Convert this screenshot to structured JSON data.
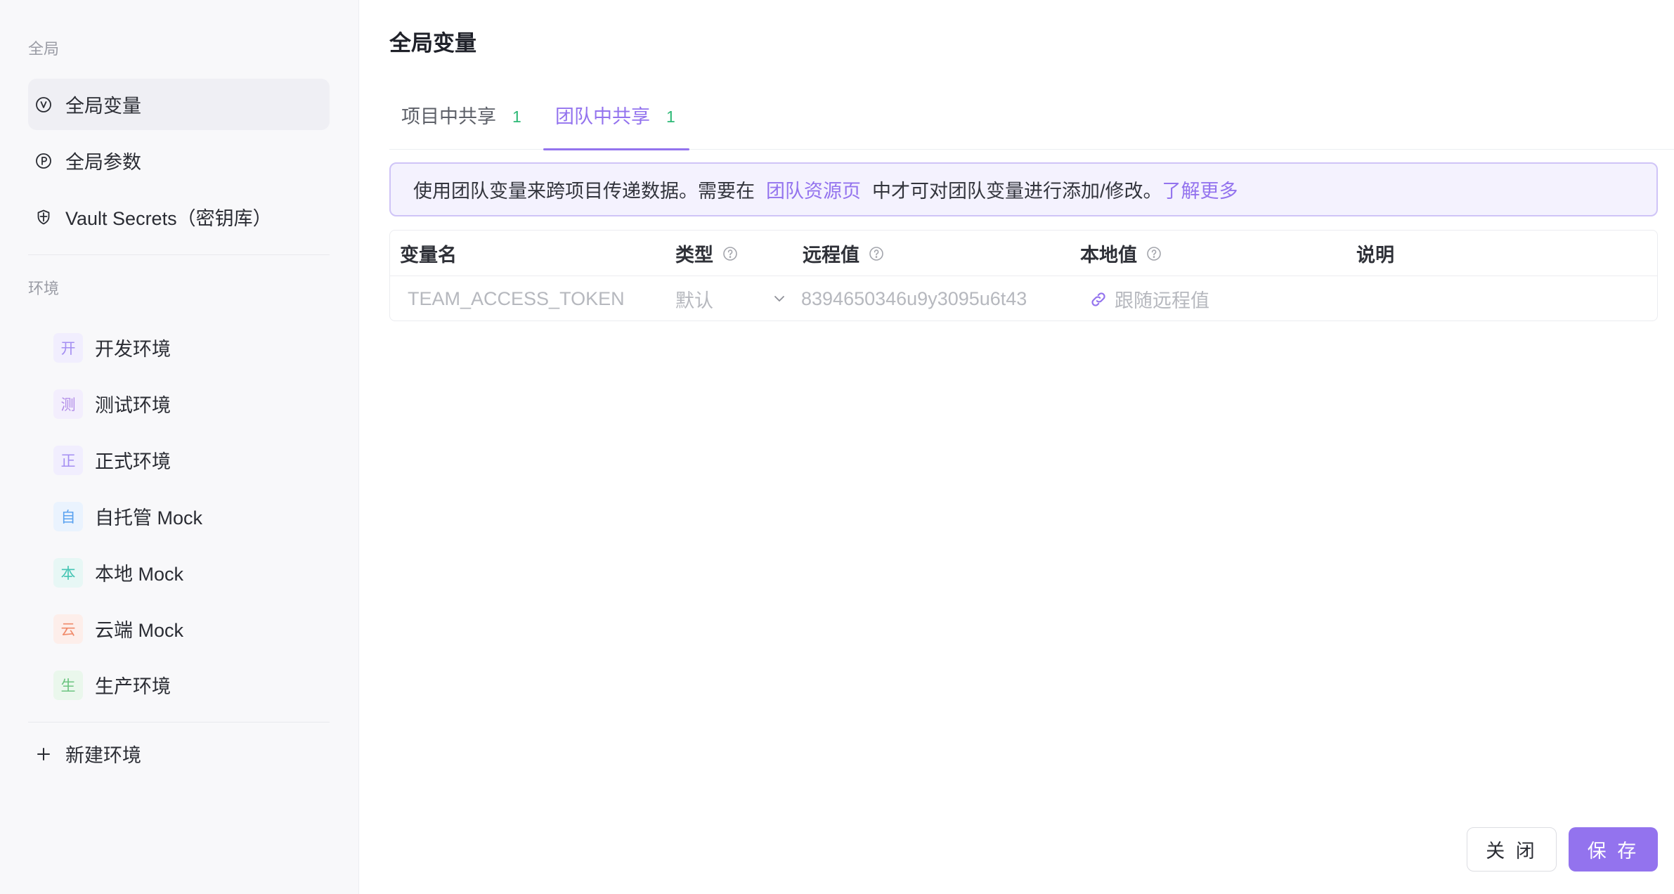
{
  "sidebar": {
    "global_section_label": "全局",
    "global_items": [
      {
        "label": "全局变量",
        "icon": "v-circle-icon",
        "active": true
      },
      {
        "label": "全局参数",
        "icon": "p-circle-icon"
      },
      {
        "label": "Vault Secrets（密钥库）",
        "icon": "shield-icon"
      }
    ],
    "env_section_label": "环境",
    "environments": [
      {
        "badge": "开",
        "label": "开发环境",
        "badge_color": "#a48ef2",
        "badge_bg": "#f1eefe"
      },
      {
        "badge": "测",
        "label": "测试环境",
        "badge_color": "#b08ae8",
        "badge_bg": "#f3eefd"
      },
      {
        "badge": "正",
        "label": "正式环境",
        "badge_color": "#a48ef2",
        "badge_bg": "#f1eefe"
      },
      {
        "badge": "自",
        "label": "自托管 Mock",
        "badge_color": "#5aa2f0",
        "badge_bg": "#eaf3fe"
      },
      {
        "badge": "本",
        "label": "本地 Mock",
        "badge_color": "#45c5b4",
        "badge_bg": "#e7f7f5"
      },
      {
        "badge": "云",
        "label": "云端 Mock",
        "badge_color": "#f08a6a",
        "badge_bg": "#fdeeea"
      },
      {
        "badge": "生",
        "label": "生产环境",
        "badge_color": "#6cc480",
        "badge_bg": "#eaf7ec"
      }
    ],
    "new_env_label": "新建环境"
  },
  "main": {
    "title": "全局变量",
    "tabs": [
      {
        "label": "项目中共享",
        "count": "1"
      },
      {
        "label": "团队中共享",
        "count": "1",
        "active": true
      }
    ],
    "banner": {
      "text_before": "使用团队变量来跨项目传递数据。需要在",
      "link_resource": "团队资源页",
      "text_after": "中才可对团队变量进行添加/修改。",
      "link_more": "了解更多"
    },
    "table": {
      "columns": [
        "变量名",
        "类型",
        "远程值",
        "本地值",
        "说明"
      ],
      "rows": [
        {
          "name": "TEAM_ACCESS_TOKEN",
          "type": "默认",
          "remote_value": "8394650346u9y3095u6t43",
          "local_value": "跟随远程值"
        }
      ]
    }
  },
  "footer": {
    "close_label": "关 闭",
    "save_label": "保 存"
  },
  "colors": {
    "accent": "#9373ee",
    "count_green": "#2db976",
    "active_item_bg": "#efeff4"
  }
}
